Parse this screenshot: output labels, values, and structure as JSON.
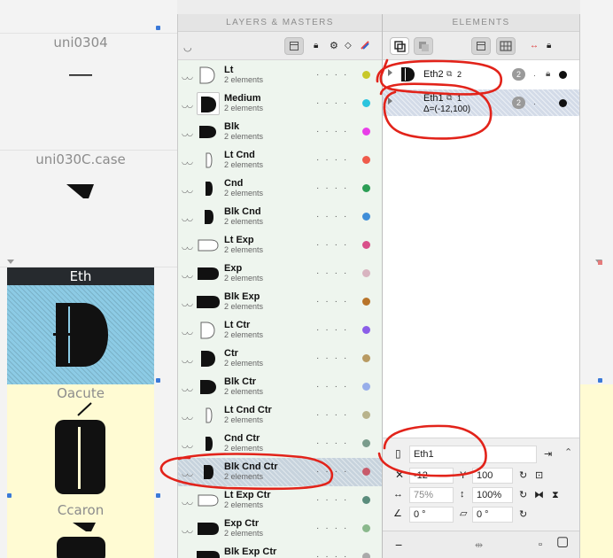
{
  "glyph_grid": {
    "cells": [
      {
        "name": "uni0304"
      },
      {
        "name": "uni030C.case"
      },
      {
        "name": "Eth"
      },
      {
        "name": "Oacute"
      },
      {
        "name": "Ccaron"
      }
    ]
  },
  "layers_panel": {
    "title": "LAYERS & MASTERS",
    "layers": [
      {
        "name": "Lt",
        "sub": "2 elements",
        "color": "#c8c82a"
      },
      {
        "name": "Medium",
        "sub": "2 elements",
        "color": "#2bc4de"
      },
      {
        "name": "Blk",
        "sub": "2 elements",
        "color": "#e83ee8"
      },
      {
        "name": "Lt Cnd",
        "sub": "2 elements",
        "color": "#ef5b4b"
      },
      {
        "name": "Cnd",
        "sub": "2 elements",
        "color": "#2c9e55"
      },
      {
        "name": "Blk Cnd",
        "sub": "2 elements",
        "color": "#3f8ed8"
      },
      {
        "name": "Lt Exp",
        "sub": "2 elements",
        "color": "#d9508a"
      },
      {
        "name": "Exp",
        "sub": "2 elements",
        "color": "#d8b4c0"
      },
      {
        "name": "Blk Exp",
        "sub": "2 elements",
        "color": "#b8742a"
      },
      {
        "name": "Lt Ctr",
        "sub": "2 elements",
        "color": "#8b5ee8"
      },
      {
        "name": "Ctr",
        "sub": "2 elements",
        "color": "#b89a62"
      },
      {
        "name": "Blk Ctr",
        "sub": "2 elements",
        "color": "#97aeea"
      },
      {
        "name": "Lt Cnd Ctr",
        "sub": "2 elements",
        "color": "#b8b38c"
      },
      {
        "name": "Cnd Ctr",
        "sub": "2 elements",
        "color": "#7a9c8c"
      },
      {
        "name": "Blk Cnd Ctr",
        "sub": "2 elements",
        "color": "#c85a6a"
      },
      {
        "name": "Lt Exp Ctr",
        "sub": "2 elements",
        "color": "#5a8c7c"
      },
      {
        "name": "Exp Ctr",
        "sub": "2 elements",
        "color": "#8ab88c"
      },
      {
        "name": "Blk Exp Ctr",
        "sub": "2 elements",
        "color": "#aaaaaa"
      }
    ]
  },
  "elements_panel": {
    "title": "ELEMENTS",
    "elements": [
      {
        "name": "Eth2",
        "count_label": "2",
        "badge": "2",
        "sub": ""
      },
      {
        "name": "Eth1",
        "count_label": "1",
        "badge": "2",
        "sub": "Δ=(-12,100)"
      }
    ],
    "transform": {
      "element_name": "Eth1",
      "x": "-12",
      "y_label": "Y",
      "y": "100",
      "width_pct": "75%",
      "height_pct": "100%",
      "angle": "0 °",
      "skew": "0 °"
    },
    "bottom_bar": {
      "remove": "−"
    }
  }
}
